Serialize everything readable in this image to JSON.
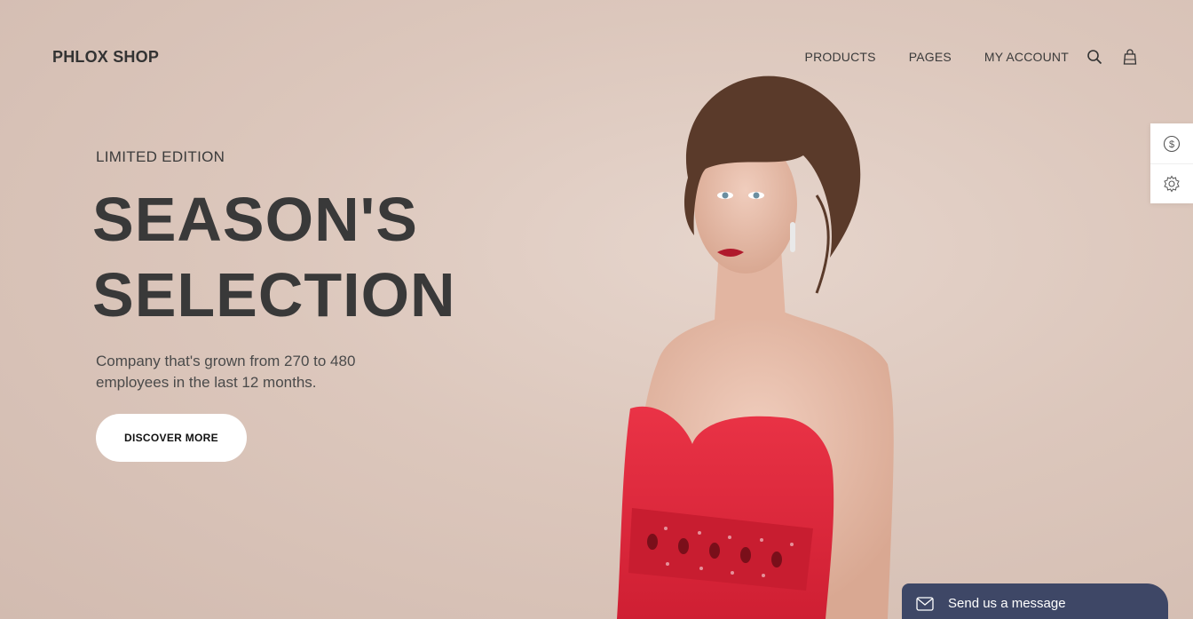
{
  "header": {
    "brand": "PHLOX SHOP",
    "nav": [
      {
        "label": "PRODUCTS"
      },
      {
        "label": "PAGES"
      },
      {
        "label": "MY ACCOUNT"
      }
    ],
    "icons": [
      "search-icon",
      "shopping-bag-icon"
    ]
  },
  "hero": {
    "eyebrow": "LIMITED EDITION",
    "headline_line1": "SEASON'S",
    "headline_line2": "SELECTION",
    "description": "Company that's grown from 270 to 480 employees in the last 12 months.",
    "cta_label": "DISCOVER MORE"
  },
  "side_panel": {
    "icons": [
      "dollar-icon",
      "gear-icon"
    ]
  },
  "chat": {
    "label": "Send us a message",
    "icon": "envelope-icon"
  },
  "colors": {
    "background": "#dfccc2",
    "text_dark": "#393939",
    "dress": "#e0273a",
    "chat_bg": "#3e4766"
  }
}
